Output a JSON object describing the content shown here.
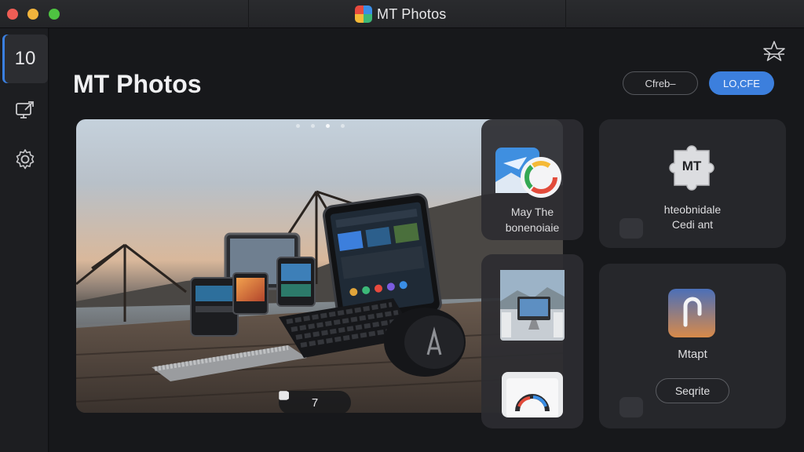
{
  "window": {
    "title": "MT Photos"
  },
  "sidebar": {
    "items": [
      {
        "label": "10"
      }
    ]
  },
  "page": {
    "title": "MT Photos"
  },
  "toolbar": {
    "outline_button": "Cfreb–",
    "primary_button": "LO,CFE"
  },
  "hero": {
    "counter_value": "7"
  },
  "mid_cards": [
    {
      "label_line1": "May The",
      "label_line2": "bonenoiaie"
    }
  ],
  "right_cards": [
    {
      "icon_text": "MT",
      "line1": "htеobnidale",
      "line2": "Cedi ant"
    },
    {
      "title": "Mtapt",
      "button": "Seqrite"
    }
  ],
  "colors": {
    "accent": "#3c7fdd",
    "background": "#17181b",
    "card": "#26272b"
  }
}
